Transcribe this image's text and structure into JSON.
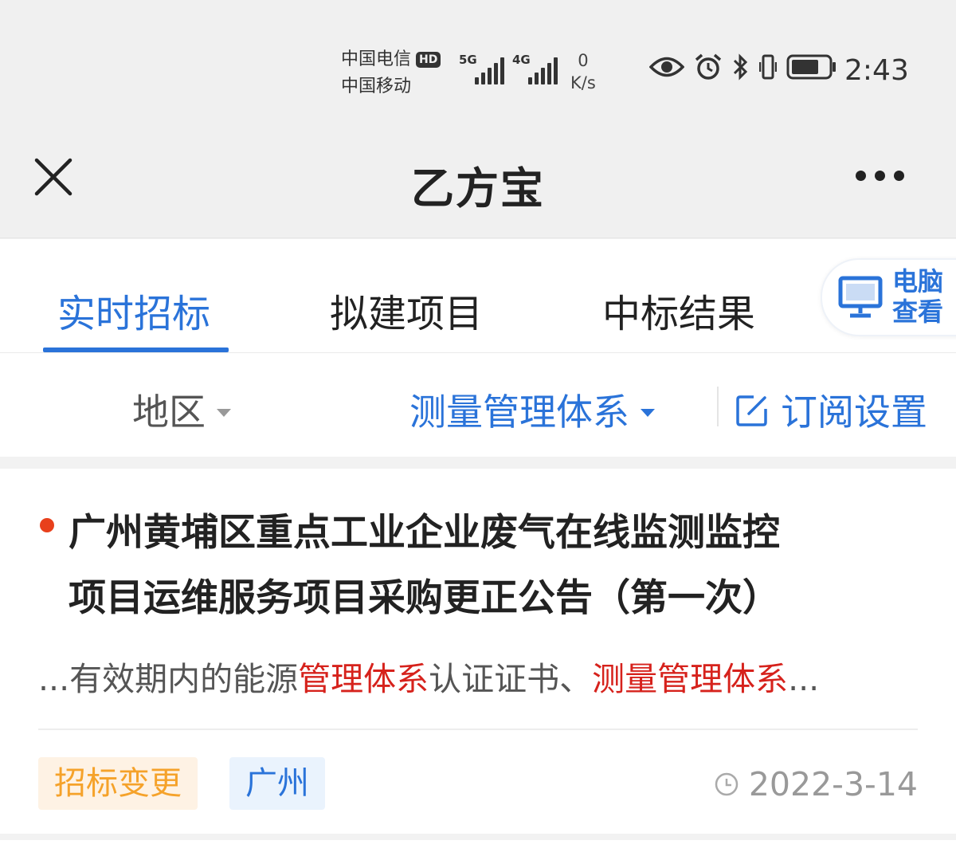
{
  "status_bar": {
    "carrier_1": "中国电信",
    "hd_badge": "HD",
    "carrier_2": "中国移动",
    "signal_1_label": "5G",
    "signal_2_label": "4G",
    "speed_value": "0",
    "speed_unit": "K/s",
    "time": "2:43",
    "icons": [
      "eye-icon",
      "alarm-icon",
      "bluetooth-icon",
      "vibrate-icon",
      "battery-icon"
    ]
  },
  "nav_bar": {
    "title": "乙方宝",
    "icons": [
      "close-icon",
      "more-icon"
    ]
  },
  "tabs": {
    "items": [
      {
        "label": "实时招标",
        "active": true
      },
      {
        "label": "拟建项目",
        "active": false
      },
      {
        "label": "中标结果",
        "active": false
      }
    ],
    "pc_view": {
      "line1": "电脑",
      "line2": "查看",
      "icon": "monitor-icon"
    }
  },
  "filters": {
    "region": "地区",
    "category": "测量管理体系",
    "subscription": "订阅设置",
    "subscription_icon": "edit-icon"
  },
  "result": {
    "title_line1": "广州黄埔区重点工业企业废气在线监测监控",
    "title_line2": "项目运维服务项目采购更正公告（第一次）",
    "snippet_prefix": "...有效期内的能源",
    "snippet_hl1": "管理体系",
    "snippet_mid": "认证证书、",
    "snippet_hl2": "测量管理体系",
    "snippet_suffix": "...",
    "tag_type": "招标变更",
    "tag_region": "广州",
    "date": "2022-3-14",
    "date_icon": "clock-icon"
  },
  "colors": {
    "accent": "#2a73d9",
    "highlight": "#d6221c",
    "dot": "#e8401c",
    "tag_orange": "#f5a22a",
    "tag_orange_bg": "#fef2e4",
    "tag_blue_bg": "#eaf3fd"
  }
}
